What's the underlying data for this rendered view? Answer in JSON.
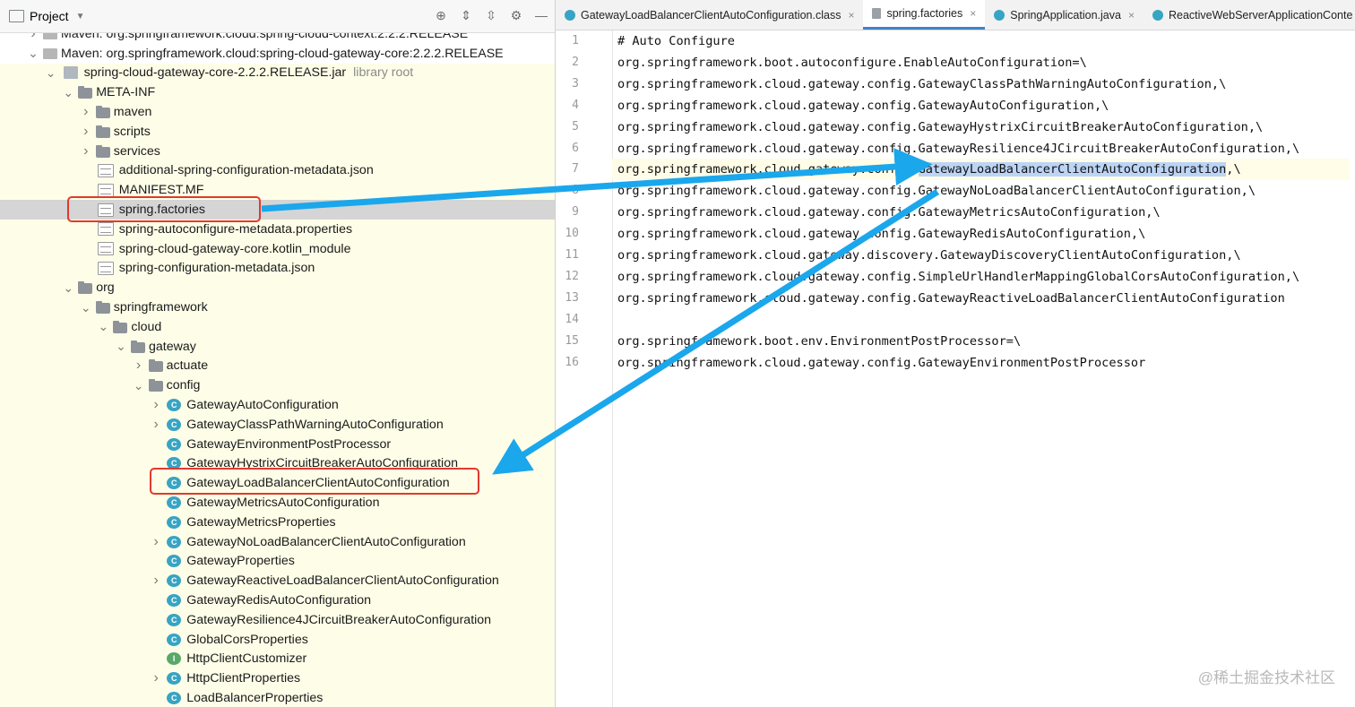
{
  "project_panel": {
    "title": "Project",
    "tree": [
      {
        "label": "Maven: org.springframework.cloud:spring-cloud-context:2.2.2.RELEASE",
        "icon": "maven-library-icon",
        "depth": 1,
        "chevron": "right"
      },
      {
        "label": "Maven: org.springframework.cloud:spring-cloud-gateway-core:2.2.2.RELEASE",
        "icon": "maven-library-icon",
        "depth": 1,
        "chevron": "down"
      },
      {
        "label": "spring-cloud-gateway-core-2.2.2.RELEASE.jar",
        "suffix": "library root",
        "icon": "jar-icon",
        "depth": 2,
        "chevron": "down"
      },
      {
        "label": "META-INF",
        "icon": "folder-icon",
        "depth": 3,
        "chevron": "down"
      },
      {
        "label": "maven",
        "icon": "folder-icon",
        "depth": 4,
        "chevron": "right"
      },
      {
        "label": "scripts",
        "icon": "folder-icon",
        "depth": 4,
        "chevron": "right"
      },
      {
        "label": "services",
        "icon": "folder-icon",
        "depth": 4,
        "chevron": "right"
      },
      {
        "label": "additional-spring-configuration-metadata.json",
        "icon": "json-file-icon",
        "depth": 4,
        "chevron": ""
      },
      {
        "label": "MANIFEST.MF",
        "icon": "manifest-file-icon",
        "depth": 4,
        "chevron": ""
      },
      {
        "label": "spring.factories",
        "icon": "text-file-icon",
        "depth": 4,
        "chevron": "",
        "selected": true
      },
      {
        "label": "spring-autoconfigure-metadata.properties",
        "icon": "properties-file-icon",
        "depth": 4,
        "chevron": ""
      },
      {
        "label": "spring-cloud-gateway-core.kotlin_module",
        "icon": "kotlin-module-file-icon",
        "depth": 4,
        "chevron": ""
      },
      {
        "label": "spring-configuration-metadata.json",
        "icon": "json-file-icon",
        "depth": 4,
        "chevron": ""
      },
      {
        "label": "org",
        "icon": "folder-icon",
        "depth": 3,
        "chevron": "down"
      },
      {
        "label": "springframework",
        "icon": "folder-icon",
        "depth": 4,
        "chevron": "down"
      },
      {
        "label": "cloud",
        "icon": "folder-icon",
        "depth": 5,
        "chevron": "down"
      },
      {
        "label": "gateway",
        "icon": "folder-icon",
        "depth": 6,
        "chevron": "down"
      },
      {
        "label": "actuate",
        "icon": "folder-icon",
        "depth": 7,
        "chevron": "right"
      },
      {
        "label": "config",
        "icon": "folder-icon",
        "depth": 7,
        "chevron": "down"
      },
      {
        "label": "GatewayAutoConfiguration",
        "icon": "class-icon",
        "depth": 8,
        "chevron": "right"
      },
      {
        "label": "GatewayClassPathWarningAutoConfiguration",
        "icon": "class-icon",
        "depth": 8,
        "chevron": "right"
      },
      {
        "label": "GatewayEnvironmentPostProcessor",
        "icon": "class-icon",
        "depth": 8,
        "chevron": ""
      },
      {
        "label": "GatewayHystrixCircuitBreakerAutoConfiguration",
        "icon": "class-icon",
        "depth": 8,
        "chevron": ""
      },
      {
        "label": "GatewayLoadBalancerClientAutoConfiguration",
        "icon": "class-icon",
        "depth": 8,
        "chevron": ""
      },
      {
        "label": "GatewayMetricsAutoConfiguration",
        "icon": "class-icon",
        "depth": 8,
        "chevron": ""
      },
      {
        "label": "GatewayMetricsProperties",
        "icon": "class-icon",
        "depth": 8,
        "chevron": ""
      },
      {
        "label": "GatewayNoLoadBalancerClientAutoConfiguration",
        "icon": "class-icon",
        "depth": 8,
        "chevron": "right"
      },
      {
        "label": "GatewayProperties",
        "icon": "class-icon",
        "depth": 8,
        "chevron": ""
      },
      {
        "label": "GatewayReactiveLoadBalancerClientAutoConfiguration",
        "icon": "class-icon",
        "depth": 8,
        "chevron": "right"
      },
      {
        "label": "GatewayRedisAutoConfiguration",
        "icon": "class-icon",
        "depth": 8,
        "chevron": ""
      },
      {
        "label": "GatewayResilience4JCircuitBreakerAutoConfiguration",
        "icon": "class-icon",
        "depth": 8,
        "chevron": ""
      },
      {
        "label": "GlobalCorsProperties",
        "icon": "class-icon",
        "depth": 8,
        "chevron": ""
      },
      {
        "label": "HttpClientCustomizer",
        "icon": "interface-icon",
        "depth": 8,
        "chevron": ""
      },
      {
        "label": "HttpClientProperties",
        "icon": "class-icon",
        "depth": 8,
        "chevron": "right"
      },
      {
        "label": "LoadBalancerProperties",
        "icon": "class-icon",
        "depth": 8,
        "chevron": ""
      }
    ]
  },
  "editor": {
    "tabs": [
      {
        "label": "GatewayLoadBalancerClientAutoConfiguration.class",
        "icon": "class-icon",
        "active": false
      },
      {
        "label": "spring.factories",
        "icon": "text-file-icon",
        "active": true
      },
      {
        "label": "SpringApplication.java",
        "icon": "class-icon",
        "active": false
      },
      {
        "label": "ReactiveWebServerApplicationConte",
        "icon": "class-icon",
        "active": false
      }
    ],
    "lines": [
      {
        "n": "1",
        "text": "# Auto Configure"
      },
      {
        "n": "2",
        "text": "org.springframework.boot.autoconfigure.EnableAutoConfiguration=\\"
      },
      {
        "n": "3",
        "text": "org.springframework.cloud.gateway.config.GatewayClassPathWarningAutoConfiguration,\\"
      },
      {
        "n": "4",
        "text": "org.springframework.cloud.gateway.config.GatewayAutoConfiguration,\\"
      },
      {
        "n": "5",
        "text": "org.springframework.cloud.gateway.config.GatewayHystrixCircuitBreakerAutoConfiguration,\\"
      },
      {
        "n": "6",
        "text": "org.springframework.cloud.gateway.config.GatewayResilience4JCircuitBreakerAutoConfiguration,\\"
      },
      {
        "n": "7",
        "text": "org.springframework.cloud.gateway.config.",
        "highlight": "GatewayLoadBalancerClientAutoConfiguration",
        "after": ",\\"
      },
      {
        "n": "8",
        "text": "org.springframework.cloud.gateway.config.GatewayNoLoadBalancerClientAutoConfiguration,\\"
      },
      {
        "n": "9",
        "text": "org.springframework.cloud.gateway.config.GatewayMetricsAutoConfiguration,\\"
      },
      {
        "n": "10",
        "text": "org.springframework.cloud.gateway.config.GatewayRedisAutoConfiguration,\\"
      },
      {
        "n": "11",
        "text": "org.springframework.cloud.gateway.discovery.GatewayDiscoveryClientAutoConfiguration,\\"
      },
      {
        "n": "12",
        "text": "org.springframework.cloud.gateway.config.SimpleUrlHandlerMappingGlobalCorsAutoConfiguration,\\"
      },
      {
        "n": "13",
        "text": "org.springframework.cloud.gateway.config.GatewayReactiveLoadBalancerClientAutoConfiguration"
      },
      {
        "n": "14",
        "text": ""
      },
      {
        "n": "15",
        "text": "org.springframework.boot.env.EnvironmentPostProcessor=\\"
      },
      {
        "n": "16",
        "text": "org.springframework.cloud.gateway.config.GatewayEnvironmentPostProcessor"
      }
    ]
  },
  "watermark": "@稀土掘金技术社区",
  "colors": {
    "annotation_arrow": "#1aa7ec",
    "annotation_box": "#e03a2c",
    "selection": "#bcd4f5"
  }
}
